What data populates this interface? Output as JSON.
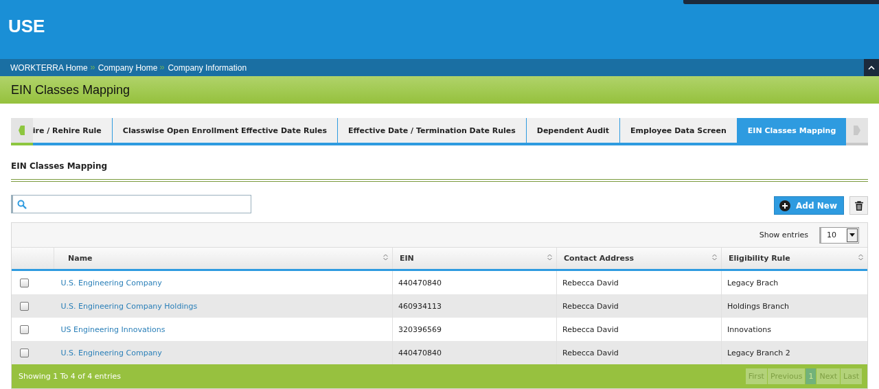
{
  "header": {
    "logo": "USE"
  },
  "breadcrumb": [
    {
      "label": "WORKTERRA Home"
    },
    {
      "label": "Company Home"
    },
    {
      "label": "Company Information"
    }
  ],
  "page_title": "EIN Classes Mapping",
  "tabs": [
    {
      "label": "ire / Rehire Rule",
      "selected": false
    },
    {
      "label": "Classwise Open Enrollment Effective Date Rules",
      "selected": false
    },
    {
      "label": "Effective Date / Termination Date Rules",
      "selected": false
    },
    {
      "label": "Dependent Audit",
      "selected": false
    },
    {
      "label": "Employee Data Screen",
      "selected": false
    },
    {
      "label": "EIN Classes Mapping",
      "selected": true
    }
  ],
  "section_title": "EIN Classes Mapping",
  "add_button": "Add New",
  "show_entries": {
    "label": "Show entries",
    "value": "10"
  },
  "table": {
    "columns": [
      "Name",
      "EIN",
      "Contact Address",
      "Eligibility Rule"
    ],
    "rows": [
      {
        "checked": false,
        "cells": [
          "U.S. Engineering Company",
          "440470840",
          "Rebecca David",
          "Legacy Brach"
        ]
      },
      {
        "checked": false,
        "cells": [
          "U.S. Engineering Company Holdings",
          "460934113",
          "Rebecca David",
          "Holdings Branch"
        ]
      },
      {
        "checked": false,
        "cells": [
          "US Engineering Innovations",
          "320396569",
          "Rebecca David",
          "Innovations"
        ]
      },
      {
        "checked": false,
        "cells": [
          "U.S. Engineering Company",
          "440470840",
          "Rebecca David",
          "Legacy Branch 2"
        ]
      }
    ]
  },
  "footer": {
    "summary": "Showing 1 To 4 of 4 entries",
    "pager": [
      {
        "label": "First",
        "selected": false
      },
      {
        "label": "Previous",
        "selected": false
      },
      {
        "label": "1",
        "selected": true
      },
      {
        "label": "Next",
        "selected": false
      },
      {
        "label": "Last",
        "selected": false
      }
    ]
  }
}
